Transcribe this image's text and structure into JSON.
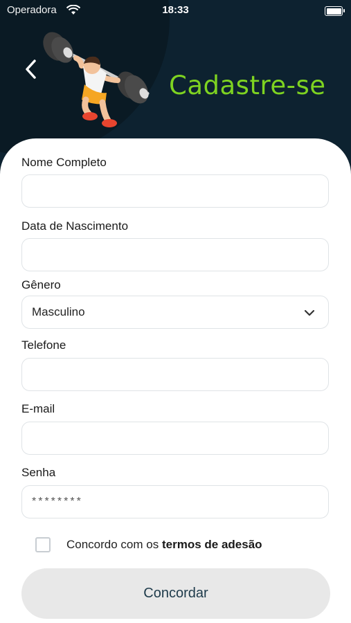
{
  "status_bar": {
    "carrier": "Operadora",
    "time": "18:33"
  },
  "header": {
    "title": "Cadastre-se",
    "title_color": "#7ed321",
    "back_icon": "chevron-left-icon",
    "illustration": "weightlifter-illustration"
  },
  "form": {
    "full_name": {
      "label": "Nome Completo",
      "value": ""
    },
    "birth_date": {
      "label": "Data de Nascimento",
      "value": ""
    },
    "gender": {
      "label": "Gênero",
      "value": "Masculino",
      "icon": "chevron-down-icon"
    },
    "phone": {
      "label": "Telefone",
      "value": ""
    },
    "email": {
      "label": "E-mail",
      "value": ""
    },
    "password": {
      "label": "Senha",
      "value": "********"
    }
  },
  "terms": {
    "text": "Concordo com os",
    "link": "termos de adesão",
    "checked": false
  },
  "submit": {
    "label": "Concordar"
  },
  "colors": {
    "header_bg": "#0d2230",
    "accent": "#7ed321",
    "button_bg": "#e8e8e8",
    "button_text": "#1d3a4a"
  }
}
